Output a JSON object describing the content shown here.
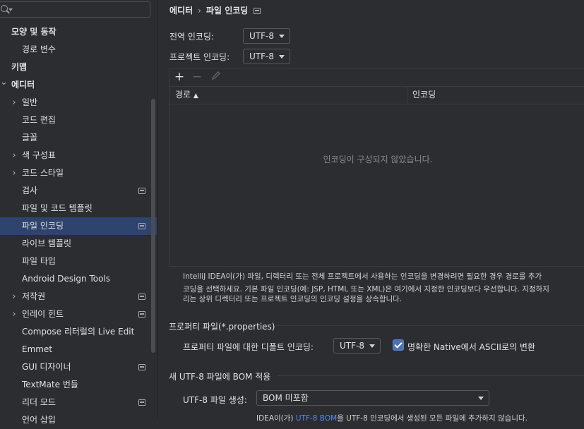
{
  "sidebar": {
    "search": {
      "value": "",
      "placeholder": ""
    },
    "items": [
      {
        "label": "모양 및 동작",
        "bold": true,
        "indent": 16,
        "arrow": "none"
      },
      {
        "label": "경로 변수",
        "indent": 31,
        "arrow": "none"
      },
      {
        "label": "키맵",
        "bold": true,
        "indent": 16,
        "arrow": "none"
      },
      {
        "label": "에디터",
        "bold": true,
        "indent": 16,
        "arrow": "down"
      },
      {
        "label": "일반",
        "indent": 31,
        "arrow": "right"
      },
      {
        "label": "코드 편집",
        "indent": 31,
        "arrow": "none"
      },
      {
        "label": "글꼴",
        "indent": 31,
        "arrow": "none"
      },
      {
        "label": "색 구성표",
        "indent": 31,
        "arrow": "right"
      },
      {
        "label": "코드 스타일",
        "indent": 31,
        "arrow": "right"
      },
      {
        "label": "검사",
        "indent": 31,
        "arrow": "none",
        "icon": "project-scope-icon"
      },
      {
        "label": "파일 및 코드 템플릿",
        "indent": 31,
        "arrow": "none"
      },
      {
        "label": "파일 인코딩",
        "indent": 31,
        "arrow": "none",
        "icon": "project-scope-icon",
        "selected": true
      },
      {
        "label": "라이브 템플릿",
        "indent": 31,
        "arrow": "none"
      },
      {
        "label": "파일 타입",
        "indent": 31,
        "arrow": "none"
      },
      {
        "label": "Android Design Tools",
        "indent": 31,
        "arrow": "none"
      },
      {
        "label": "저작권",
        "indent": 31,
        "arrow": "right",
        "icon": "project-scope-icon"
      },
      {
        "label": "인레이 힌트",
        "indent": 31,
        "arrow": "right",
        "icon": "project-scope-icon"
      },
      {
        "label": "Compose 리터럴의 Live Edit",
        "indent": 31,
        "arrow": "none"
      },
      {
        "label": "Emmet",
        "indent": 31,
        "arrow": "none"
      },
      {
        "label": "GUI 디자이너",
        "indent": 31,
        "arrow": "none",
        "icon": "project-scope-icon"
      },
      {
        "label": "TextMate 번들",
        "indent": 31,
        "arrow": "none"
      },
      {
        "label": "리더 모드",
        "indent": 31,
        "arrow": "none",
        "icon": "project-scope-icon"
      },
      {
        "label": "언어 삽입",
        "indent": 31,
        "arrow": "none"
      }
    ]
  },
  "breadcrumb": {
    "parent": "에디터",
    "separator": "›",
    "current": "파일 인코딩"
  },
  "global_encoding": {
    "label": "전역 인코딩:",
    "value": "UTF-8"
  },
  "project_encoding": {
    "label": "프로젝트 인코딩:",
    "value": "UTF-8"
  },
  "table": {
    "toolbar": {
      "add": "+",
      "remove": "−"
    },
    "columns": {
      "path": "경로",
      "sort_indicator": "▲",
      "encoding": "인코딩"
    },
    "empty_text": "인코딩이 구성되지 않았습니다."
  },
  "description": {
    "line1": "IntelliJ IDEA이(가) 파일, 디렉터리 또는 전체 프로젝트에서 사용하는 인코딩을 변경하려면 필요한 경우 경로를 추가",
    "line2": "코딩을 선택하세요. 기본 파일 인코딩(예: JSP, HTML 또는 XML)은 여기에서 지정한 인코딩보다 우선합니다. 지정하지",
    "line3": "리는 상위 디렉터리 또는 프로젝트 인코딩의 인코딩 설정을 상속합니다."
  },
  "properties": {
    "title": "프로퍼티 파일(*.properties)",
    "default_label": "프로퍼티 파일에 대한 디폴트 인코딩:",
    "default_value": "UTF-8",
    "native_ascii_label": "명확한 Native에서 ASCII로의 변환",
    "native_ascii_checked": true
  },
  "bom": {
    "title": "새 UTF-8 파일에 BOM 적용",
    "create_label": "UTF-8 파일 생성:",
    "create_value": "BOM 미포함",
    "note_prefix": "IDEA이(가) ",
    "note_link": "UTF-8 BOM",
    "note_suffix": "을 UTF-8 인코딩에서 생성된 모든 파일에 추가하지 않습니다."
  },
  "colors": {
    "accent": "#4c72b4",
    "selection": "#2e436e",
    "link": "#548af7",
    "background": "#2b2d30"
  }
}
